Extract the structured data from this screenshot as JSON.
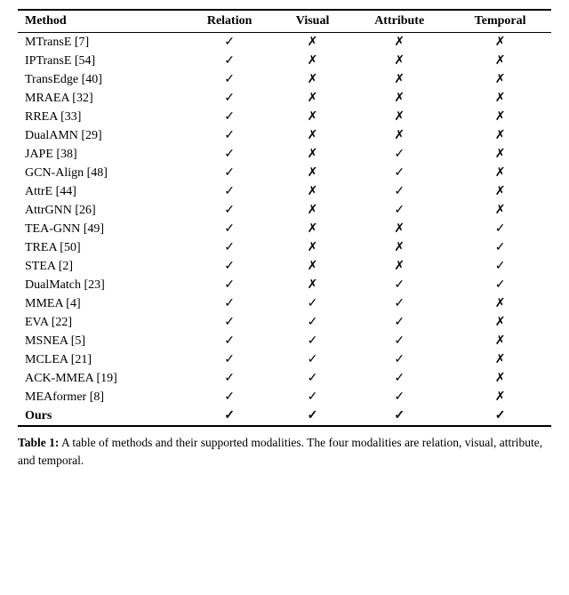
{
  "table": {
    "headers": [
      "Method",
      "Relation",
      "Visual",
      "Attribute",
      "Temporal"
    ],
    "rows": [
      {
        "method": "MTransE [7]",
        "relation": "✓",
        "visual": "✗",
        "attribute": "✗",
        "temporal": "✗",
        "bold": false
      },
      {
        "method": "IPTransE [54]",
        "relation": "✓",
        "visual": "✗",
        "attribute": "✗",
        "temporal": "✗",
        "bold": false
      },
      {
        "method": "TransEdge [40]",
        "relation": "✓",
        "visual": "✗",
        "attribute": "✗",
        "temporal": "✗",
        "bold": false
      },
      {
        "method": "MRAEA [32]",
        "relation": "✓",
        "visual": "✗",
        "attribute": "✗",
        "temporal": "✗",
        "bold": false
      },
      {
        "method": "RREA [33]",
        "relation": "✓",
        "visual": "✗",
        "attribute": "✗",
        "temporal": "✗",
        "bold": false
      },
      {
        "method": "DualAMN [29]",
        "relation": "✓",
        "visual": "✗",
        "attribute": "✗",
        "temporal": "✗",
        "bold": false
      },
      {
        "method": "JAPE [38]",
        "relation": "✓",
        "visual": "✗",
        "attribute": "✓",
        "temporal": "✗",
        "bold": false
      },
      {
        "method": "GCN-Align [48]",
        "relation": "✓",
        "visual": "✗",
        "attribute": "✓",
        "temporal": "✗",
        "bold": false
      },
      {
        "method": "AttrE [44]",
        "relation": "✓",
        "visual": "✗",
        "attribute": "✓",
        "temporal": "✗",
        "bold": false
      },
      {
        "method": "AttrGNN [26]",
        "relation": "✓",
        "visual": "✗",
        "attribute": "✓",
        "temporal": "✗",
        "bold": false
      },
      {
        "method": "TEA-GNN [49]",
        "relation": "✓",
        "visual": "✗",
        "attribute": "✗",
        "temporal": "✓",
        "bold": false
      },
      {
        "method": "TREA [50]",
        "relation": "✓",
        "visual": "✗",
        "attribute": "✗",
        "temporal": "✓",
        "bold": false
      },
      {
        "method": "STEA [2]",
        "relation": "✓",
        "visual": "✗",
        "attribute": "✗",
        "temporal": "✓",
        "bold": false
      },
      {
        "method": "DualMatch [23]",
        "relation": "✓",
        "visual": "✗",
        "attribute": "✓",
        "temporal": "✓",
        "bold": false
      },
      {
        "method": "MMEA [4]",
        "relation": "✓",
        "visual": "✓",
        "attribute": "✓",
        "temporal": "✗",
        "bold": false
      },
      {
        "method": "EVA [22]",
        "relation": "✓",
        "visual": "✓",
        "attribute": "✓",
        "temporal": "✗",
        "bold": false
      },
      {
        "method": "MSNEA [5]",
        "relation": "✓",
        "visual": "✓",
        "attribute": "✓",
        "temporal": "✗",
        "bold": false
      },
      {
        "method": "MCLEA [21]",
        "relation": "✓",
        "visual": "✓",
        "attribute": "✓",
        "temporal": "✗",
        "bold": false
      },
      {
        "method": "ACK-MMEA [19]",
        "relation": "✓",
        "visual": "✓",
        "attribute": "✓",
        "temporal": "✗",
        "bold": false
      },
      {
        "method": "MEAformer [8]",
        "relation": "✓",
        "visual": "✓",
        "attribute": "✓",
        "temporal": "✗",
        "bold": false
      },
      {
        "method": "Ours",
        "relation": "✓",
        "visual": "✓",
        "attribute": "✓",
        "temporal": "✓",
        "bold": true
      }
    ]
  },
  "caption": {
    "label": "Table 1:",
    "text": " A table of methods and their supported modalities. The four modalities are relation, visual, attribute, and temporal."
  }
}
